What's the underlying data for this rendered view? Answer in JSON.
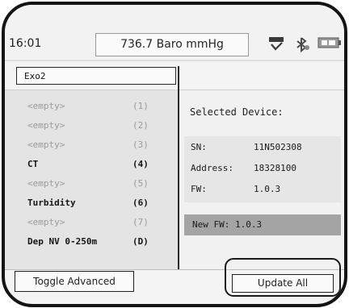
{
  "status_bar": {
    "time": "16:01",
    "barometer": "736.7 Baro mmHg",
    "icons": [
      "gps-signal-icon",
      "bluetooth-icon",
      "battery-icon"
    ]
  },
  "device_name": "Exo2",
  "channels": [
    {
      "label": "<empty>",
      "port": "(1)",
      "state": "empty"
    },
    {
      "label": "<empty>",
      "port": "(2)",
      "state": "empty"
    },
    {
      "label": "<empty>",
      "port": "(3)",
      "state": "empty"
    },
    {
      "label": "CT",
      "port": "(4)",
      "state": "used"
    },
    {
      "label": "<empty>",
      "port": "(5)",
      "state": "empty"
    },
    {
      "label": "Turbidity",
      "port": "(6)",
      "state": "used"
    },
    {
      "label": "<empty>",
      "port": "(7)",
      "state": "empty"
    },
    {
      "label": "Dep NV 0-250m",
      "port": "(D)",
      "state": "used"
    }
  ],
  "selected_device": {
    "title": "Selected Device:",
    "sn_label": "SN:",
    "sn_value": "11N502308",
    "address_label": "Address:",
    "address_value": "18328100",
    "fw_label": "FW:",
    "fw_value": "1.0.3",
    "new_fw": "New FW: 1.0.3"
  },
  "buttons": {
    "toggle_advanced": "Toggle Advanced",
    "update_all": "Update All"
  },
  "colors": {
    "frame": "#141414",
    "panel": "#e4e4e4",
    "highlight": "#a4a4a4"
  }
}
